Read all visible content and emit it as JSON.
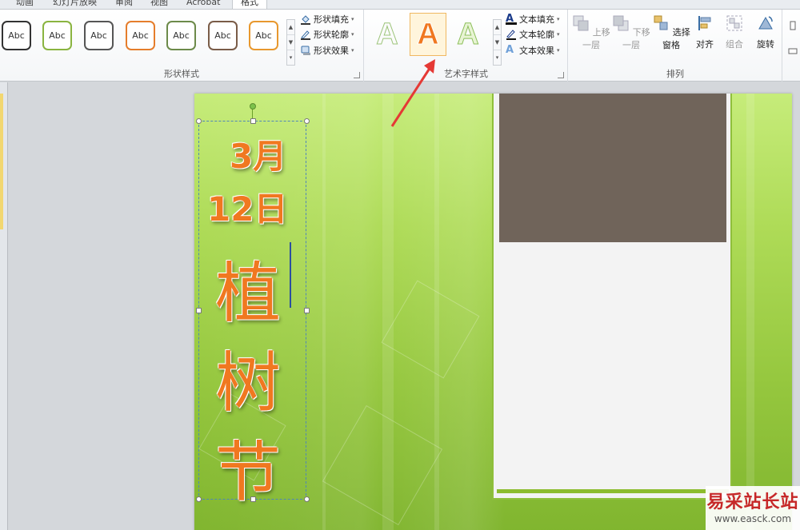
{
  "tabs": [
    {
      "label": "动画"
    },
    {
      "label": "幻灯片放映"
    },
    {
      "label": "审阅"
    },
    {
      "label": "视图"
    },
    {
      "label": "Acrobat"
    },
    {
      "label": "格式"
    }
  ],
  "shape_styles": {
    "label": "形状样式",
    "thumb_text": "Abc",
    "colors": [
      "#333333",
      "#8ab440",
      "#555555",
      "#e57d2c",
      "#6c8a4a",
      "#7a5c48",
      "#e8982e"
    ],
    "fill": "形状填充",
    "outline": "形状轮廓",
    "effects": "形状效果"
  },
  "wordart_styles": {
    "label": "艺术字样式",
    "glyph": "A",
    "text_fill": "文本填充",
    "text_outline": "文本轮廓",
    "text_effects": "文本效果"
  },
  "arrange": {
    "label": "排列",
    "bring_forward": "上移一层",
    "send_backward": "下移一层",
    "selection_pane": "选择窗格",
    "align": "对齐",
    "group": "组合",
    "rotate": "旋转"
  },
  "slide": {
    "line1": "3月",
    "line2": "12日",
    "chars": [
      "植",
      "树",
      "节"
    ],
    "brown_color": "#70645a",
    "text_color": "#f07820"
  },
  "watermark": {
    "title": "易采站长站",
    "url": "www.easck.com"
  }
}
